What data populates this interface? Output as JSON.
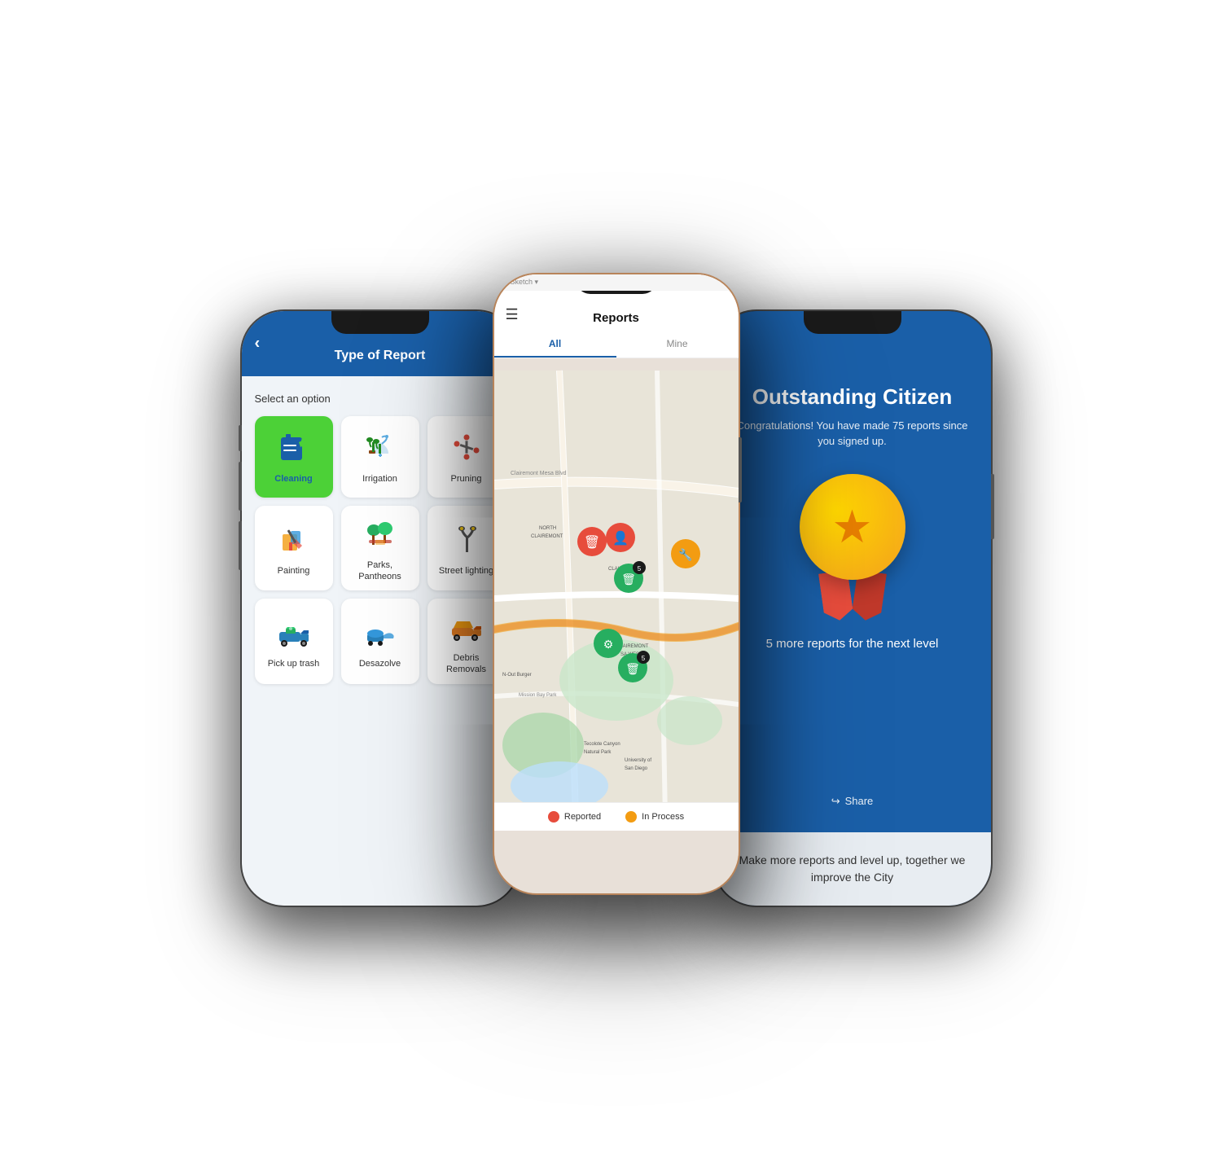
{
  "phone1": {
    "header": {
      "title": "Type of Report",
      "back_label": "‹"
    },
    "body": {
      "select_label": "Select an option",
      "grid": [
        [
          {
            "id": "cleaning",
            "label": "Cleaning",
            "icon": "🗑",
            "active": true
          },
          {
            "id": "irrigation",
            "label": "Irrigation",
            "icon": "🪴",
            "active": false
          },
          {
            "id": "pruning",
            "label": "Pruning",
            "icon": "✂",
            "active": false
          }
        ],
        [
          {
            "id": "painting",
            "label": "Painting",
            "icon": "🏠",
            "active": false
          },
          {
            "id": "parks",
            "label": "Parks, Pantheons",
            "icon": "🌳",
            "active": false
          },
          {
            "id": "street-lighting",
            "label": "Street lighting",
            "icon": "💡",
            "active": false
          }
        ],
        [
          {
            "id": "pickup",
            "label": "Pick up trash",
            "icon": "🚛",
            "active": false
          },
          {
            "id": "desazolve",
            "label": "Desazolve",
            "icon": "💧",
            "active": false
          },
          {
            "id": "debris",
            "label": "Debris Removals",
            "icon": "🚜",
            "active": false
          }
        ]
      ]
    }
  },
  "phone2": {
    "sketch_label": "Sketch ▾",
    "header": {
      "title": "Reports",
      "menu_icon": "☰"
    },
    "tabs": [
      {
        "label": "All",
        "active": true
      },
      {
        "label": "Mine",
        "active": false
      }
    ],
    "legend": [
      {
        "label": "Reported",
        "color": "#e74c3c"
      },
      {
        "label": "In Process",
        "color": "#f39c12"
      }
    ]
  },
  "phone3": {
    "header": {
      "back_label": "‹"
    },
    "content": {
      "title": "Outstanding Citizen",
      "subtitle": "Congratulations! You have made 75 reports since you signed up.",
      "next_level": "5 more reports for the next level",
      "share_label": "Share"
    },
    "footer": {
      "text": "Make more reports and level up, together we improve the City"
    }
  }
}
